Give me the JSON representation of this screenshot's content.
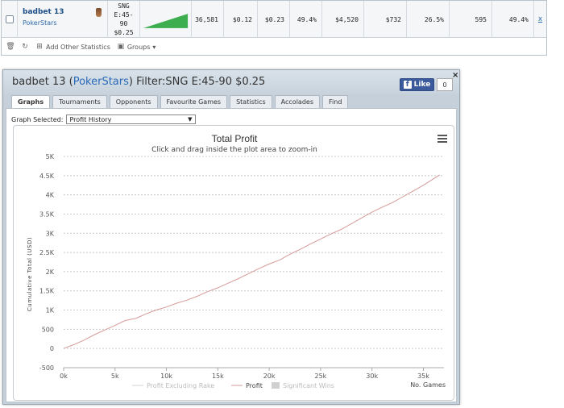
{
  "stats_row": {
    "player_name": "badbet 13",
    "site": "PokerStars",
    "game_lines": [
      "SNG",
      "E:45-",
      "90",
      "$0.25"
    ],
    "values": [
      "36,581",
      "$0.12",
      "$0.23",
      "49.4%",
      "$4,520",
      "$732",
      "26.5%",
      "595",
      "49.4%"
    ],
    "remove_label": "x"
  },
  "toolbar": {
    "add_stats_label": "Add Other Statistics",
    "groups_label": "Groups"
  },
  "popup": {
    "title_player": "badbet 13 (",
    "title_site": "PokerStars",
    "title_filter": ") Filter:SNG E:45-90 $0.25",
    "fb_like_label": "Like",
    "fb_count": "0",
    "close_label": "×",
    "tabs": [
      "Graphs",
      "Tournaments",
      "Opponents",
      "Favourite Games",
      "Statistics",
      "Accolades",
      "Find"
    ],
    "graph_selected_label": "Graph Selected:",
    "graph_selected_value": "Profit History"
  },
  "colors": {
    "profit_line": "#d69a9a",
    "excluding_rake_line": "#d0d0d0",
    "significant_wins": "#d0d0d0",
    "spark_fill": "#3cae4f"
  },
  "chart_data": {
    "type": "line",
    "title": "Total Profit",
    "subtitle": "Click and drag inside the plot area to zoom-in",
    "ylabel": "Cumulative Total (USD)",
    "xlabel": "No. Games",
    "ylim": [
      -500,
      5000
    ],
    "xlim": [
      0,
      37000
    ],
    "y_ticks": [
      "-500",
      "0",
      "500",
      "1K",
      "1.5K",
      "2K",
      "2.5K",
      "3K",
      "3.5K",
      "4K",
      "4.5K",
      "5K"
    ],
    "y_tick_values": [
      -500,
      0,
      500,
      1000,
      1500,
      2000,
      2500,
      3000,
      3500,
      4000,
      4500,
      5000
    ],
    "x_ticks": [
      "0k",
      "5k",
      "10k",
      "15k",
      "20k",
      "25k",
      "30k",
      "35k"
    ],
    "x_tick_values": [
      0,
      5000,
      10000,
      15000,
      20000,
      25000,
      30000,
      35000
    ],
    "legend": [
      "Profit Excluding Rake",
      "Profit",
      "Significant Wins"
    ],
    "legend_position": "bottom-center",
    "grid": true,
    "series": [
      {
        "name": "Profit",
        "x": [
          0,
          1000,
          2000,
          3000,
          4000,
          5000,
          6000,
          7000,
          8000,
          9000,
          10000,
          11000,
          12000,
          13000,
          14000,
          15000,
          16000,
          17000,
          18000,
          19000,
          20000,
          21000,
          22000,
          23000,
          24000,
          25000,
          26000,
          27000,
          28000,
          29000,
          30000,
          31000,
          32000,
          33000,
          34000,
          35000,
          36581
        ],
        "y": [
          0,
          100,
          220,
          360,
          480,
          600,
          730,
          780,
          900,
          1000,
          1080,
          1180,
          1260,
          1360,
          1480,
          1580,
          1700,
          1820,
          1950,
          2080,
          2200,
          2300,
          2450,
          2580,
          2720,
          2850,
          2980,
          3100,
          3250,
          3400,
          3550,
          3680,
          3800,
          3950,
          4100,
          4250,
          4520
        ]
      }
    ]
  }
}
